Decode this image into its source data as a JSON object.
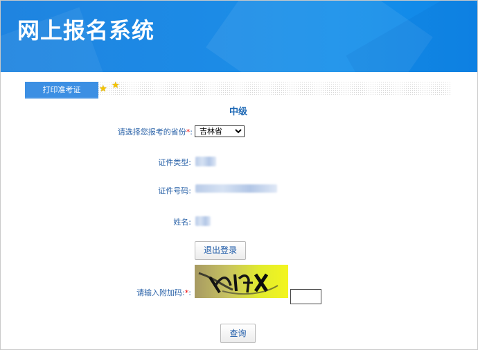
{
  "header": {
    "title": "网上报名系统"
  },
  "tab": {
    "label": "打印准考证"
  },
  "form": {
    "level": "中级",
    "province": {
      "label": "请选择您报考的省份",
      "required_mark": "*",
      "suffix": ":",
      "selected": "吉林省"
    },
    "id_type": {
      "label": "证件类型:"
    },
    "id_number": {
      "label": "证件号码:"
    },
    "name": {
      "label": "姓名:"
    },
    "logout_button": "退出登录",
    "captcha": {
      "label": "请输入附加码:",
      "required_mark": "*",
      "suffix": ":"
    },
    "query_button": "查询"
  },
  "colors": {
    "banner": "#1f84e0",
    "tab": "#3c8fe3",
    "label": "#2a62a8",
    "required": "#e00000"
  },
  "icons": [
    "star-icon",
    "star-icon"
  ]
}
